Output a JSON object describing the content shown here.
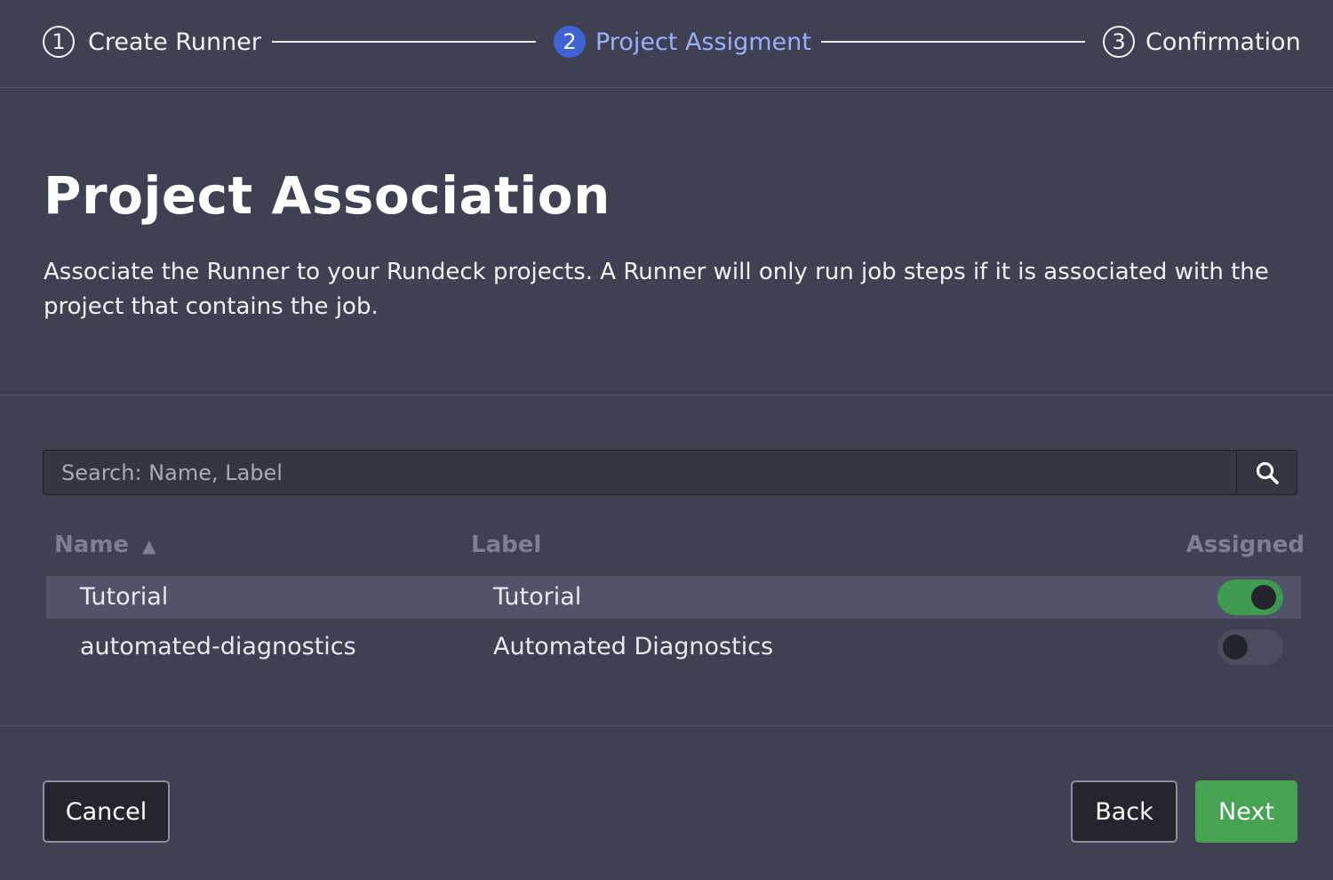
{
  "stepper": {
    "steps": [
      {
        "number": "1",
        "label": "Create Runner",
        "state": "complete"
      },
      {
        "number": "2",
        "label": "Project Assigment",
        "state": "active"
      },
      {
        "number": "3",
        "label": "Confirmation",
        "state": "upcoming"
      }
    ]
  },
  "header": {
    "title": "Project Association",
    "description": "Associate the Runner to your Rundeck projects. A Runner will only run job steps if it is associated with the project that contains the job."
  },
  "search": {
    "placeholder": "Search: Name, Label",
    "value": "",
    "icon": "search-icon"
  },
  "table": {
    "columns": {
      "name": "Name",
      "name_sort_indicator": "▲",
      "label": "Label",
      "assigned": "Assigned"
    },
    "rows": [
      {
        "name": "Tutorial",
        "label": "Tutorial",
        "assigned": true
      },
      {
        "name": "automated-diagnostics",
        "label": "Automated Diagnostics",
        "assigned": false
      }
    ]
  },
  "footer": {
    "cancel_label": "Cancel",
    "back_label": "Back",
    "next_label": "Next"
  },
  "colors": {
    "background": "#3f4051",
    "accent_blue": "#3f62d4",
    "active_step_text": "#9ab0ff",
    "toggle_on": "#3e9a4f",
    "next_button": "#45a352"
  }
}
